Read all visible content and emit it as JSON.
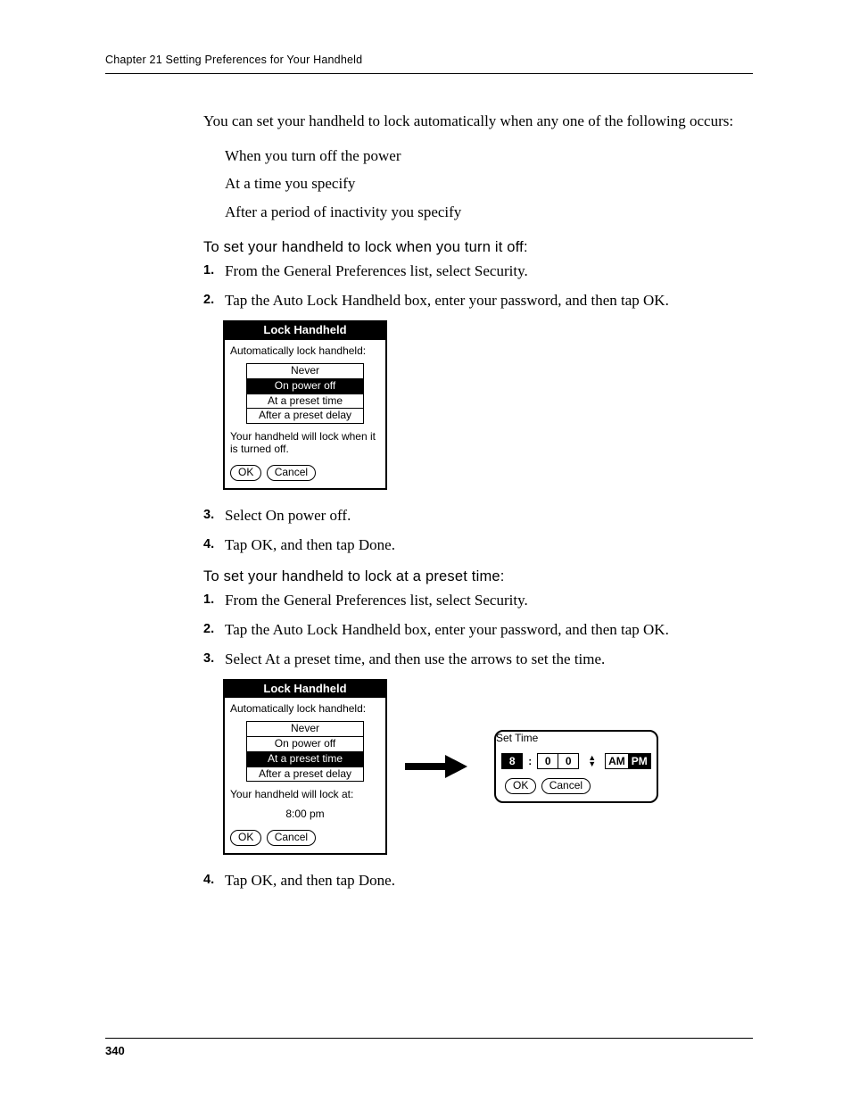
{
  "header": {
    "text": "Chapter 21   Setting Preferences for Your Handheld"
  },
  "intro": "You can set your handheld to lock automatically when any one of the following occurs:",
  "bullets": [
    "When you turn off the power",
    "At a time you specify",
    "After a period of inactivity you specify"
  ],
  "sectionA": {
    "title": "To set your handheld to lock when you turn it off:",
    "steps": [
      "From the General Preferences list, select Security.",
      "Tap the Auto Lock Handheld box, enter your password, and then tap OK.",
      "Select On power off.",
      "Tap OK, and then tap Done."
    ]
  },
  "sectionB": {
    "title": "To set your handheld to lock at a preset time:",
    "steps": [
      "From the General Preferences list, select Security.",
      "Tap the Auto Lock Handheld box, enter your password, and then tap OK.",
      "Select At a preset time, and then use the arrows to set the time.",
      "Tap OK, and then tap Done."
    ]
  },
  "dialog1": {
    "title": "Lock Handheld",
    "prompt": "Automatically lock handheld:",
    "options": [
      "Never",
      "On power off",
      "At a preset time",
      "After a preset delay"
    ],
    "selected": "On power off",
    "note": "Your handheld will lock when it is turned off.",
    "ok": "OK",
    "cancel": "Cancel"
  },
  "dialog2": {
    "title": "Lock Handheld",
    "prompt": "Automatically lock handheld:",
    "options": [
      "Never",
      "On power off",
      "At a preset time",
      "After a preset delay"
    ],
    "selected": "At a preset time",
    "note": "Your handheld will lock at:",
    "time": "8:00 pm",
    "ok": "OK",
    "cancel": "Cancel"
  },
  "settime": {
    "title": "Set Time",
    "hour": "8",
    "m1": "0",
    "m2": "0",
    "am": "AM",
    "pm": "PM",
    "ampm_selected": "PM",
    "ok": "OK",
    "cancel": "Cancel"
  },
  "footer": {
    "page": "340"
  }
}
